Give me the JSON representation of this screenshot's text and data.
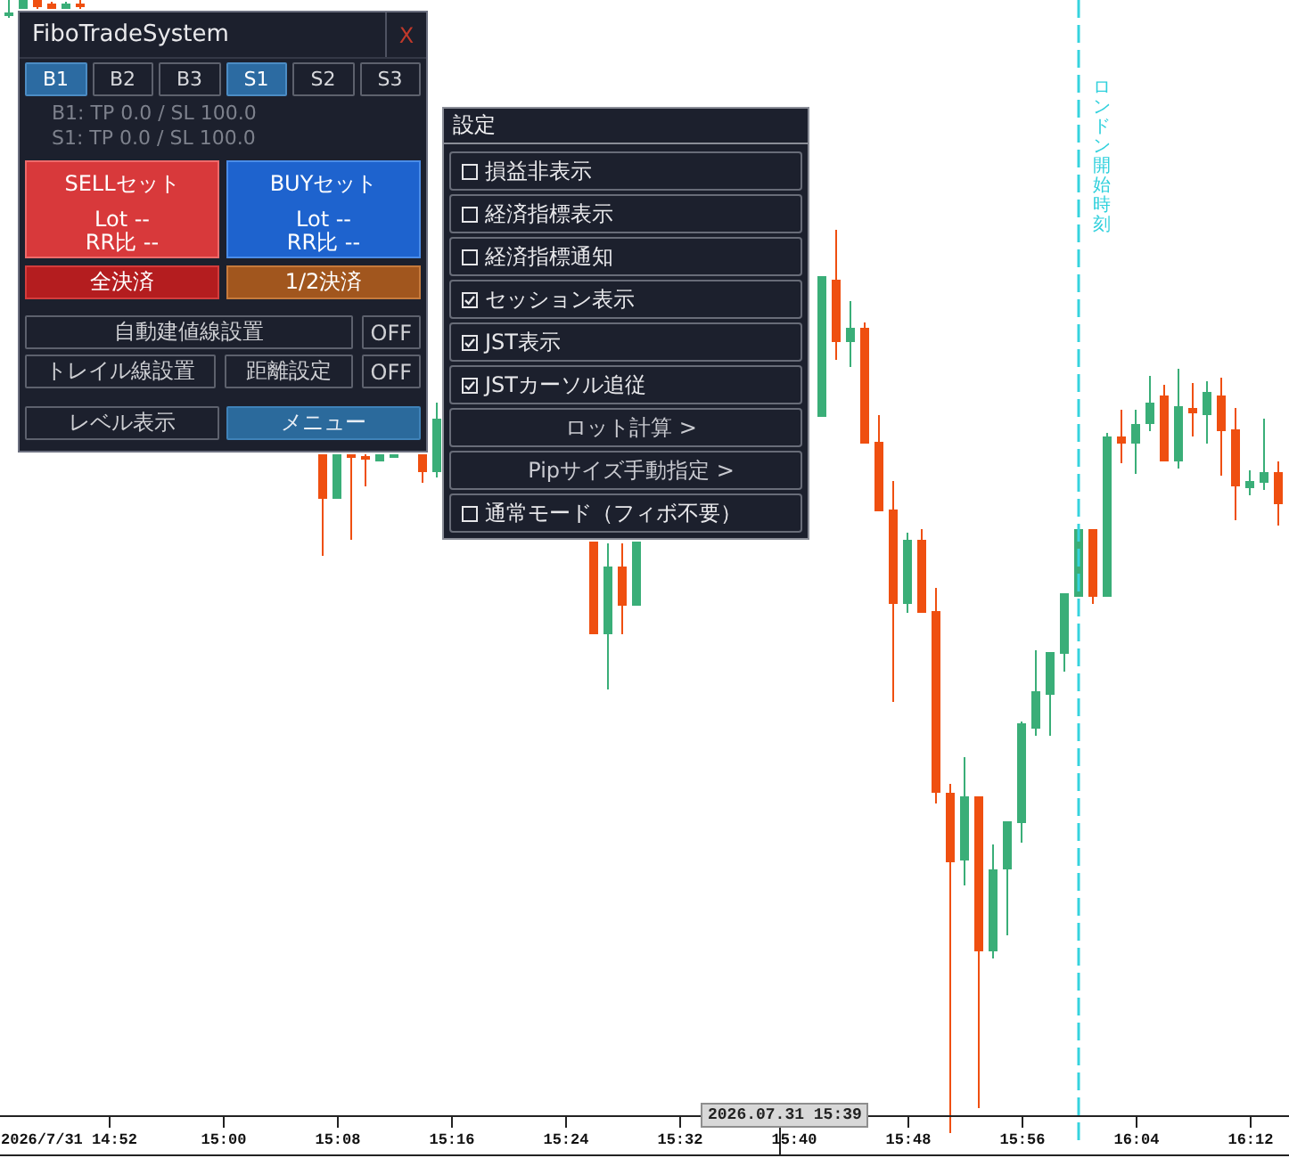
{
  "panel": {
    "title": "FiboTradeSystem",
    "close_label": "X",
    "tabs": [
      {
        "label": "B1",
        "selected": true
      },
      {
        "label": "B2",
        "selected": false
      },
      {
        "label": "B3",
        "selected": false
      },
      {
        "label": "S1",
        "selected": true
      },
      {
        "label": "S2",
        "selected": false
      },
      {
        "label": "S3",
        "selected": false
      }
    ],
    "info_lines": [
      "B1: TP 0.0 / SL 100.0",
      "S1: TP 0.0 / SL 100.0"
    ],
    "order_buttons": [
      {
        "kind": "sell",
        "title": "SELLセット",
        "lot": "Lot --",
        "rr": "RR比 --"
      },
      {
        "kind": "buy",
        "title": "BUYセット",
        "lot": "Lot --",
        "rr": "RR比 --"
      }
    ],
    "close_buttons": [
      {
        "kind": "full",
        "label": "全決済"
      },
      {
        "kind": "half",
        "label": "1/2決済"
      }
    ],
    "setting_rows": [
      [
        {
          "kind": "setting",
          "label": "自動建値線設置"
        },
        {
          "kind": "toggle",
          "label": "OFF"
        }
      ],
      [
        {
          "kind": "setting",
          "label": "トレイル線設置"
        },
        {
          "kind": "setting",
          "label": "距離設定"
        },
        {
          "kind": "toggle",
          "label": "OFF"
        }
      ]
    ],
    "bottom_buttons": [
      {
        "kind": "plain",
        "label": "レベル表示"
      },
      {
        "kind": "accent",
        "label": "メニュー"
      }
    ]
  },
  "menu": {
    "title": "設定",
    "items": [
      {
        "kind": "checkbox",
        "label": "損益非表示",
        "checked": false
      },
      {
        "kind": "checkbox",
        "label": "経済指標表示",
        "checked": false
      },
      {
        "kind": "checkbox",
        "label": "経済指標通知",
        "checked": false
      },
      {
        "kind": "checkbox",
        "label": "セッション表示",
        "checked": true
      },
      {
        "kind": "checkbox",
        "label": "JST表示",
        "checked": true
      },
      {
        "kind": "checkbox",
        "label": "JSTカーソル追従",
        "checked": true
      },
      {
        "kind": "submenu",
        "label": "ロット計算 >"
      },
      {
        "kind": "submenu",
        "label": "Pipサイズ手動指定 >"
      },
      {
        "kind": "checkbox",
        "label": "通常モード（フィボ不要）",
        "checked": false
      }
    ]
  },
  "chart": {
    "session_label": "ロンドン開始時刻",
    "time_labels": [
      "2026/7/31 14:52",
      "15:00",
      "15:08",
      "15:16",
      "15:24",
      "15:32",
      "15:40",
      "15:48",
      "15:56",
      "16:04",
      "16:12"
    ],
    "crosshair_time": "2026.07.31 15:39"
  }
}
